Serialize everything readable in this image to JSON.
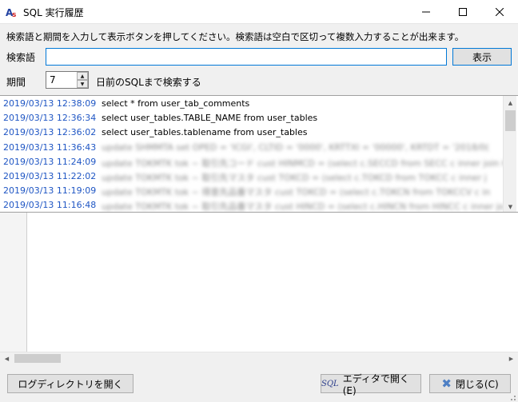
{
  "window": {
    "title": "SQL 実行履歴",
    "app_icon": "app-logo-icon",
    "minimize_icon": "minimize-icon",
    "maximize_icon": "maximize-icon",
    "close_icon": "close-icon"
  },
  "instruction": "検索語と期間を入力して表示ボタンを押してください。検索語は空白で区切って複数入力することが出来ます。",
  "search": {
    "label": "検索語",
    "value": "",
    "placeholder": "",
    "button_label": "表示"
  },
  "period": {
    "label": "期間",
    "value": "7",
    "suffix": "日前のSQLまで検索する"
  },
  "history": {
    "rows": [
      {
        "time": "2019/03/13 12:38:09",
        "sql": "select * from user_tab_comments",
        "blurred": false
      },
      {
        "time": "2019/03/13 12:36:34",
        "sql": "select user_tables.TABLE_NAME from user_tables",
        "blurred": false
      },
      {
        "time": "2019/03/13 12:36:02",
        "sql": "select user_tables.tablename from user_tables",
        "blurred": false
      },
      {
        "time": "2019/03/13 11:36:43",
        "sql": "update SHMMTA set OPED = 'ICGI', CLTID = '0000', KRTTXI = '00000', KRTDT = '2018/0(",
        "blurred": true
      },
      {
        "time": "2019/03/13 11:24:09",
        "sql": "update TOKMTK tok ~ 取引先コード cust HINMCD = (select c.SECCD from SECC c inner join HII",
        "blurred": true
      },
      {
        "time": "2019/03/13 11:22:02",
        "sql": "update TOKMTK tok ~ 取引先マスタ cust TOKCD = (select c.TOKCD from TOKCC c inner j",
        "blurred": true
      },
      {
        "time": "2019/03/13 11:19:09",
        "sql": "update TOKMTK tok ~ 得意先品番マスタ cust TOKCD = (select c.TOKCN from TOKCCV c in",
        "blurred": true
      },
      {
        "time": "2019/03/13 11:16:48",
        "sql": "update TOKMTK tok ~ 取引先品番マスタ cust HINCD = (select c.HINCN from HINCC c inner jo",
        "blurred": true
      }
    ]
  },
  "buttons": {
    "log_dir": "ログディレクトリを開く",
    "open_editor_prefix": "SQL",
    "open_editor": "エディタで開く(E)",
    "close": "閉じる(C)"
  },
  "colors": {
    "timestamp": "#1f56c4",
    "accent_border": "#0078d7",
    "button_face": "#e1e1e1"
  }
}
